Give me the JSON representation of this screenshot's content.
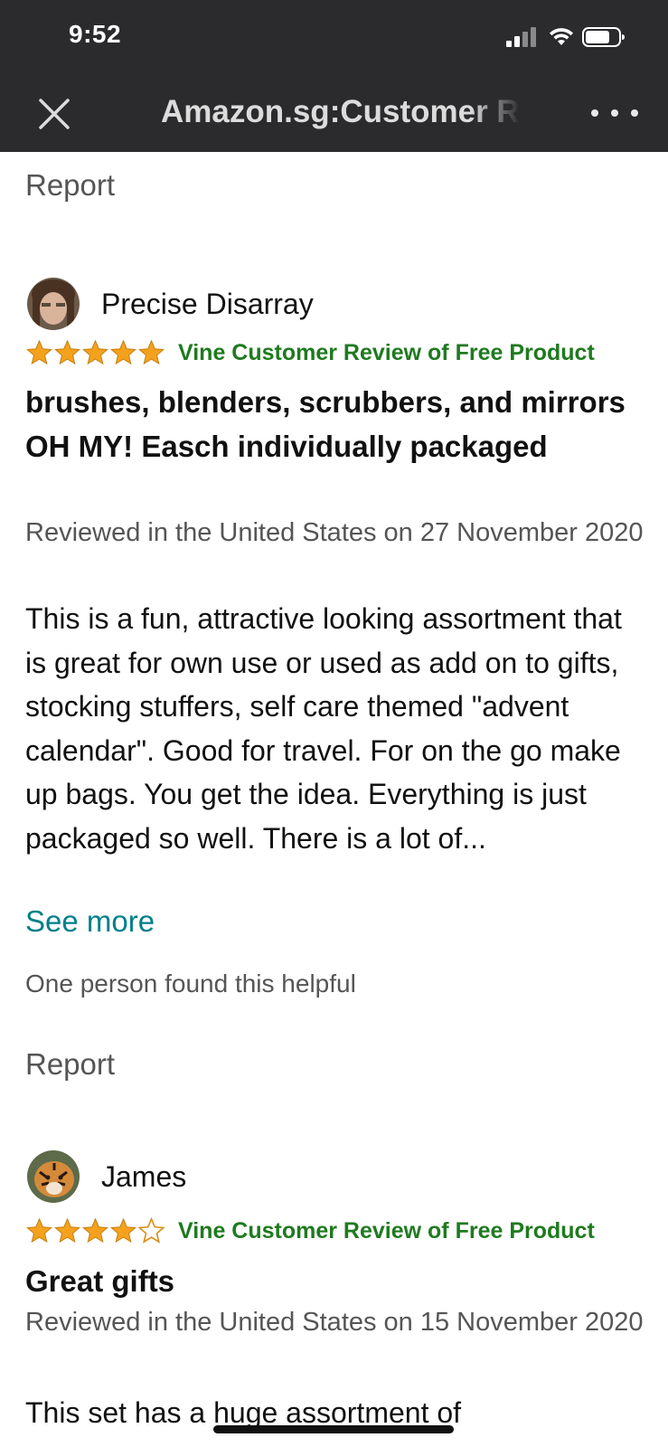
{
  "status_bar": {
    "time": "9:52"
  },
  "nav": {
    "title": "Amazon.sg:Customer Reviews",
    "close_icon": "close-icon",
    "more_icon": "more-horizontal-icon"
  },
  "colors": {
    "topbar": "#2b2b2d",
    "star": "#f4a11d",
    "vine_green": "#1f7a1f",
    "link_teal": "#00808a",
    "muted_text": "#555555"
  },
  "report_label_top": "Report",
  "reviews": [
    {
      "reviewer": "Precise Disarray",
      "rating": 5,
      "badge": "Vine Customer Review of Free Product",
      "title": "brushes, blenders, scrubbers, and mirrors OH MY! Easch individually packaged",
      "date": "Reviewed in the United States on 27 November 2020",
      "body": "This is a fun, attractive looking assortment that is great for own use or used as add on to gifts, stocking stuffers, self care themed \"advent calendar\". Good for travel. For on the go make up bags. You get the idea. Everything is just packaged so well. There is a lot of...",
      "see_more": "See more",
      "helpful": "One person found this helpful",
      "report": "Report"
    },
    {
      "reviewer": "James",
      "rating": 4,
      "badge": "Vine Customer Review of Free Product",
      "title": "Great gifts",
      "date": "Reviewed in the United States on 15 November 2020",
      "body": "This set has a huge assortment of"
    }
  ]
}
